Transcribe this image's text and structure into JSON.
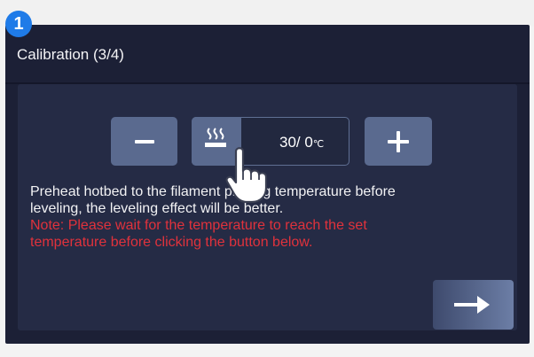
{
  "step": {
    "number": "1"
  },
  "screen": {
    "title": "Calibration (3/4)"
  },
  "controls": {
    "decrease_icon": "minus-icon",
    "increase_icon": "plus-icon",
    "heat_icon": "hotbed-heat-icon",
    "temperature": {
      "current_and_target": "30/ 0",
      "unit": "℃"
    }
  },
  "info": {
    "line1": "Preheat hotbed to the filament printing temperature before",
    "line2": "leveling, the leveling effect will be better.",
    "note_line1": "Note: Please wait for the temperature to reach the set",
    "note_line2": "temperature before clicking the button below."
  },
  "next": {
    "icon": "arrow-right-icon"
  },
  "colors": {
    "screen_bg": "#1c2036",
    "panel_bg": "#252b45",
    "button_bg": "#5a6a8f",
    "note_red": "#e0323c",
    "badge_blue": "#1f7be8"
  }
}
